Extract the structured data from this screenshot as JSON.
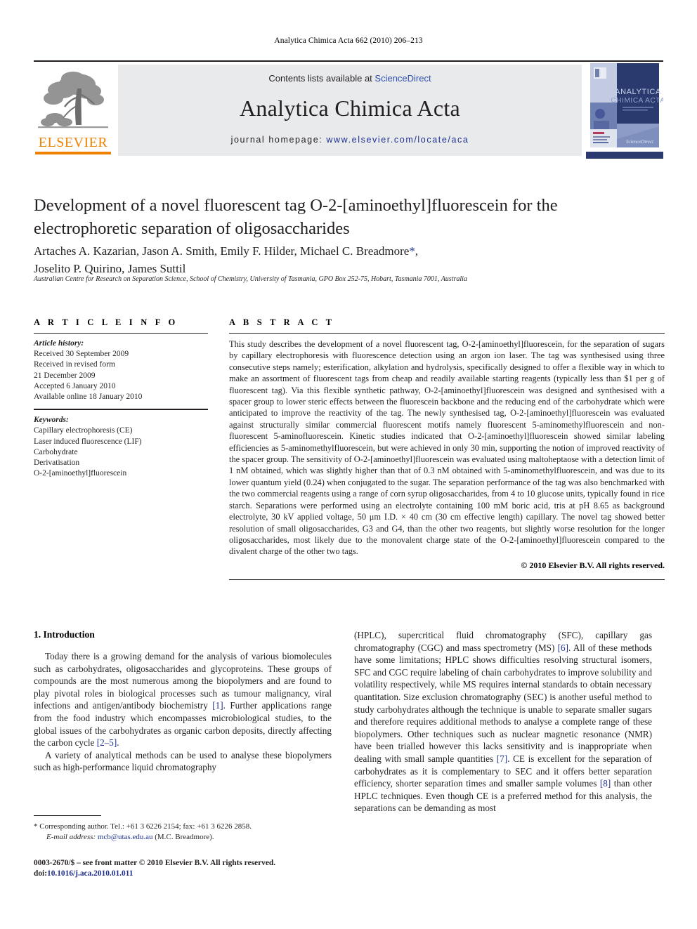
{
  "running_head": "Analytica Chimica Acta 662 (2010) 206–213",
  "masthead": {
    "contents_prefix": "Contents lists available at ",
    "sciencedirect": "ScienceDirect",
    "journal_name": "Analytica Chimica Acta",
    "homepage_prefix": "journal homepage: ",
    "homepage_url": "www.elsevier.com/locate/aca",
    "publisher": "ELSEVIER",
    "publisher_accent": "#ef8200",
    "link_color": "#1d2f8f",
    "band_color": "#e9eaeb",
    "cover_title_line1": "ANALYTICA",
    "cover_title_line2": "CHIMICA ACTA"
  },
  "article": {
    "title": "Development of a novel fluorescent tag O-2-[aminoethyl]fluorescein for the electrophoretic separation of oligosaccharides",
    "authors": "Artaches A. Kazarian, Jason A. Smith, Emily F. Hilder, Michael C. Breadmore",
    "authors_line2": "Joselito P. Quirino, James Suttil",
    "corresponding_marker": "*",
    "affiliation": "Australian Centre for Research on Separation Science, School of Chemistry, University of Tasmania, GPO Box 252-75, Hobart, Tasmania 7001, Australia"
  },
  "article_info": {
    "heading": "A R T I C L E    I N F O",
    "history_label": "Article history:",
    "history": [
      "Received 30 September 2009",
      "Received in revised form",
      "21 December 2009",
      "Accepted 6 January 2010",
      "Available online 18 January 2010"
    ],
    "keywords_label": "Keywords:",
    "keywords": [
      "Capillary electrophoresis (CE)",
      "Laser induced fluorescence (LIF)",
      "Carbohydrate",
      "Derivatisation",
      "O-2-[aminoethyl]fluorescein"
    ]
  },
  "abstract": {
    "heading": "A B S T R A C T",
    "text": "This study describes the development of a novel fluorescent tag, O-2-[aminoethyl]fluorescein, for the separation of sugars by capillary electrophoresis with fluorescence detection using an argon ion laser. The tag was synthesised using three consecutive steps namely; esterification, alkylation and hydrolysis, specifically designed to offer a flexible way in which to make an assortment of fluorescent tags from cheap and readily available starting reagents (typically less than $1 per g of fluorescent tag). Via this flexible synthetic pathway, O-2-[aminoethyl]fluorescein was designed and synthesised with a spacer group to lower steric effects between the fluorescein backbone and the reducing end of the carbohydrate which were anticipated to improve the reactivity of the tag. The newly synthesised tag, O-2-[aminoethyl]fluorescein was evaluated against structurally similar commercial fluorescent motifs namely fluorescent 5-aminomethylfluorescein and non-fluorescent 5-aminofluorescein. Kinetic studies indicated that O-2-[aminoethyl]fluorescein showed similar labeling efficiencies as 5-aminomethylfluorescein, but were achieved in only 30 min, supporting the notion of improved reactivity of the spacer group. The sensitivity of O-2-[aminoethyl]fluorescein was evaluated using maltoheptaose with a detection limit of 1 nM obtained, which was slightly higher than that of 0.3 nM obtained with 5-aminomethylfluorescein, and was due to its lower quantum yield (0.24) when conjugated to the sugar. The separation performance of the tag was also benchmarked with the two commercial reagents using a range of corn syrup oligosaccharides, from 4 to 10 glucose units, typically found in rice starch. Separations were performed using an electrolyte containing 100 mM boric acid, tris at pH 8.65 as background electrolyte, 30 kV applied voltage, 50 μm I.D. × 40 cm (30 cm effective length) capillary. The novel tag showed better resolution of small oligosaccharides, G3 and G4, than the other two reagents, but slightly worse resolution for the longer oligosaccharides, most likely due to the monovalent charge state of the O-2-[aminoethyl]fluorescein compared to the divalent charge of the other two tags.",
    "copyright": "© 2010 Elsevier B.V. All rights reserved."
  },
  "introduction": {
    "heading": "1. Introduction",
    "left_para_1_a": "Today there is a growing demand for the analysis of various biomolecules such as carbohydrates, oligosaccharides and glycoproteins. These groups of compounds are the most numerous among the biopolymers and are found to play pivotal roles in biological processes such as tumour malignancy, viral infections and antigen/antibody biochemistry ",
    "left_para_1_cite": "[1]",
    "left_para_1_b": ". Further applications range from the food industry which encompasses microbiological studies, to the global issues of the carbohydrates as organic carbon deposits, directly affecting the carbon cycle ",
    "left_para_1_cite2": "[2–5]",
    "left_para_1_c": ".",
    "left_para_2": "A variety of analytical methods can be used to analyse these biopolymers such as high-performance liquid chromatography",
    "right_para_a": "(HPLC), supercritical fluid chromatography (SFC), capillary gas chromatography (CGC) and mass spectrometry (MS) ",
    "right_cite_6": "[6]",
    "right_para_b": ". All of these methods have some limitations; HPLC shows difficulties resolving structural isomers, SFC and CGC require labeling of chain carbohydrates to improve solubility and volatility respectively, while MS requires internal standards to obtain necessary quantitation. Size exclusion chromatography (SEC) is another useful method to study carbohydrates although the technique is unable to separate smaller sugars and therefore requires additional methods to analyse a complete range of these biopolymers. Other techniques such as nuclear magnetic resonance (NMR) have been trialled however this lacks sensitivity and is inappropriate when dealing with small sample quantities ",
    "right_cite_7": "[7]",
    "right_para_c": ". CE is excellent for the separation of carbohydrates as it is complementary to SEC and it offers better separation efficiency, shorter separation times and smaller sample volumes ",
    "right_cite_8": "[8]",
    "right_para_d": " than other HPLC techniques. Even though CE is a preferred method for this analysis, the separations can be demanding as most"
  },
  "footnotes": {
    "corresponding": "* Corresponding author. Tel.: +61 3 6226 2154; fax: +61 3 6226 2858.",
    "email_label": "E-mail address:",
    "email": "mcb@utas.edu.au",
    "email_suffix": "(M.C. Breadmore).",
    "issn_line": "0003-2670/$ – see front matter © 2010 Elsevier B.V. All rights reserved.",
    "doi_label": "doi:",
    "doi": "10.1016/j.aca.2010.01.011"
  }
}
